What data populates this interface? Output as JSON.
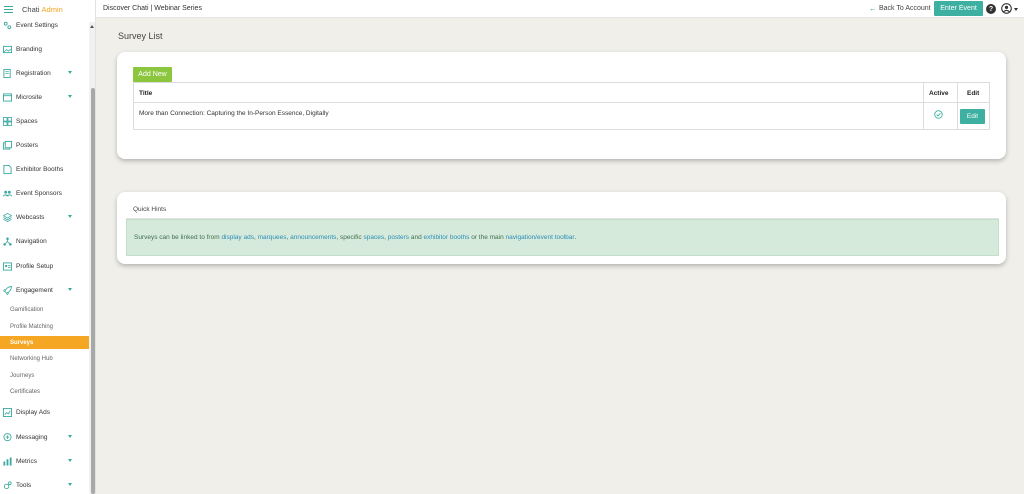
{
  "brand": {
    "name": "Chati",
    "accent": "Admin"
  },
  "topbar": {
    "breadcrumb": "Discover Chati | Webinar Series",
    "back_label": "Back To Account",
    "enter_label": "Enter Event",
    "help_glyph": "?"
  },
  "sidebar": {
    "items": [
      {
        "label": "Event Settings",
        "icon": "settings-icon"
      },
      {
        "label": "Branding",
        "icon": "image-icon"
      },
      {
        "label": "Registration",
        "icon": "form-icon"
      },
      {
        "label": "Microsite",
        "icon": "browser-icon"
      },
      {
        "label": "Spaces",
        "icon": "grid-icon"
      },
      {
        "label": "Posters",
        "icon": "poster-icon"
      },
      {
        "label": "Exhibitor Booths",
        "icon": "booth-icon"
      },
      {
        "label": "Event Sponsors",
        "icon": "people-icon"
      },
      {
        "label": "Webcasts",
        "icon": "webcast-icon"
      },
      {
        "label": "Navigation",
        "icon": "navigation-icon"
      },
      {
        "label": "Profile Setup",
        "icon": "profile-icon"
      },
      {
        "label": "Engagement",
        "icon": "rocket-icon"
      },
      {
        "label": "Display Ads",
        "icon": "chart-icon"
      },
      {
        "label": "Messaging",
        "icon": "message-icon"
      },
      {
        "label": "Metrics",
        "icon": "metrics-icon"
      },
      {
        "label": "Tools",
        "icon": "tools-icon"
      }
    ],
    "sub_items": [
      {
        "label": "Gamification"
      },
      {
        "label": "Profile Matching"
      },
      {
        "label": "Surveys"
      },
      {
        "label": "Networking Hub"
      },
      {
        "label": "Journeys"
      },
      {
        "label": "Certificates"
      }
    ]
  },
  "main": {
    "title": "Survey List",
    "add_label": "Add New",
    "columns": [
      "Title",
      "Active",
      "Edit"
    ],
    "rows": [
      {
        "title": "More than Connection: Capturing the In-Person Essence, Digitally",
        "active": true,
        "edit_label": "Edit"
      }
    ]
  },
  "hints": {
    "title": "Quick Hints",
    "text_1": "Surveys can be linked to from ",
    "link_display_ads": "display ads",
    "sep_1": ", ",
    "link_marquees": "marquees",
    "sep_2": ", ",
    "link_announcements": "announcements",
    "text_2": ", specific ",
    "link_spaces": "spaces",
    "sep_3": ", ",
    "link_posters": "posters",
    "text_3": " and ",
    "link_exhibitor_booths": "exhibitor booths",
    "text_4": " or the main ",
    "link_toolbar": "navigation/event toolbar",
    "text_5": "."
  },
  "colors": {
    "accent_teal": "#3eb0a2",
    "accent_orange": "#f5a623",
    "add_green": "#8cc63f",
    "hint_bg": "#d6eadc"
  }
}
